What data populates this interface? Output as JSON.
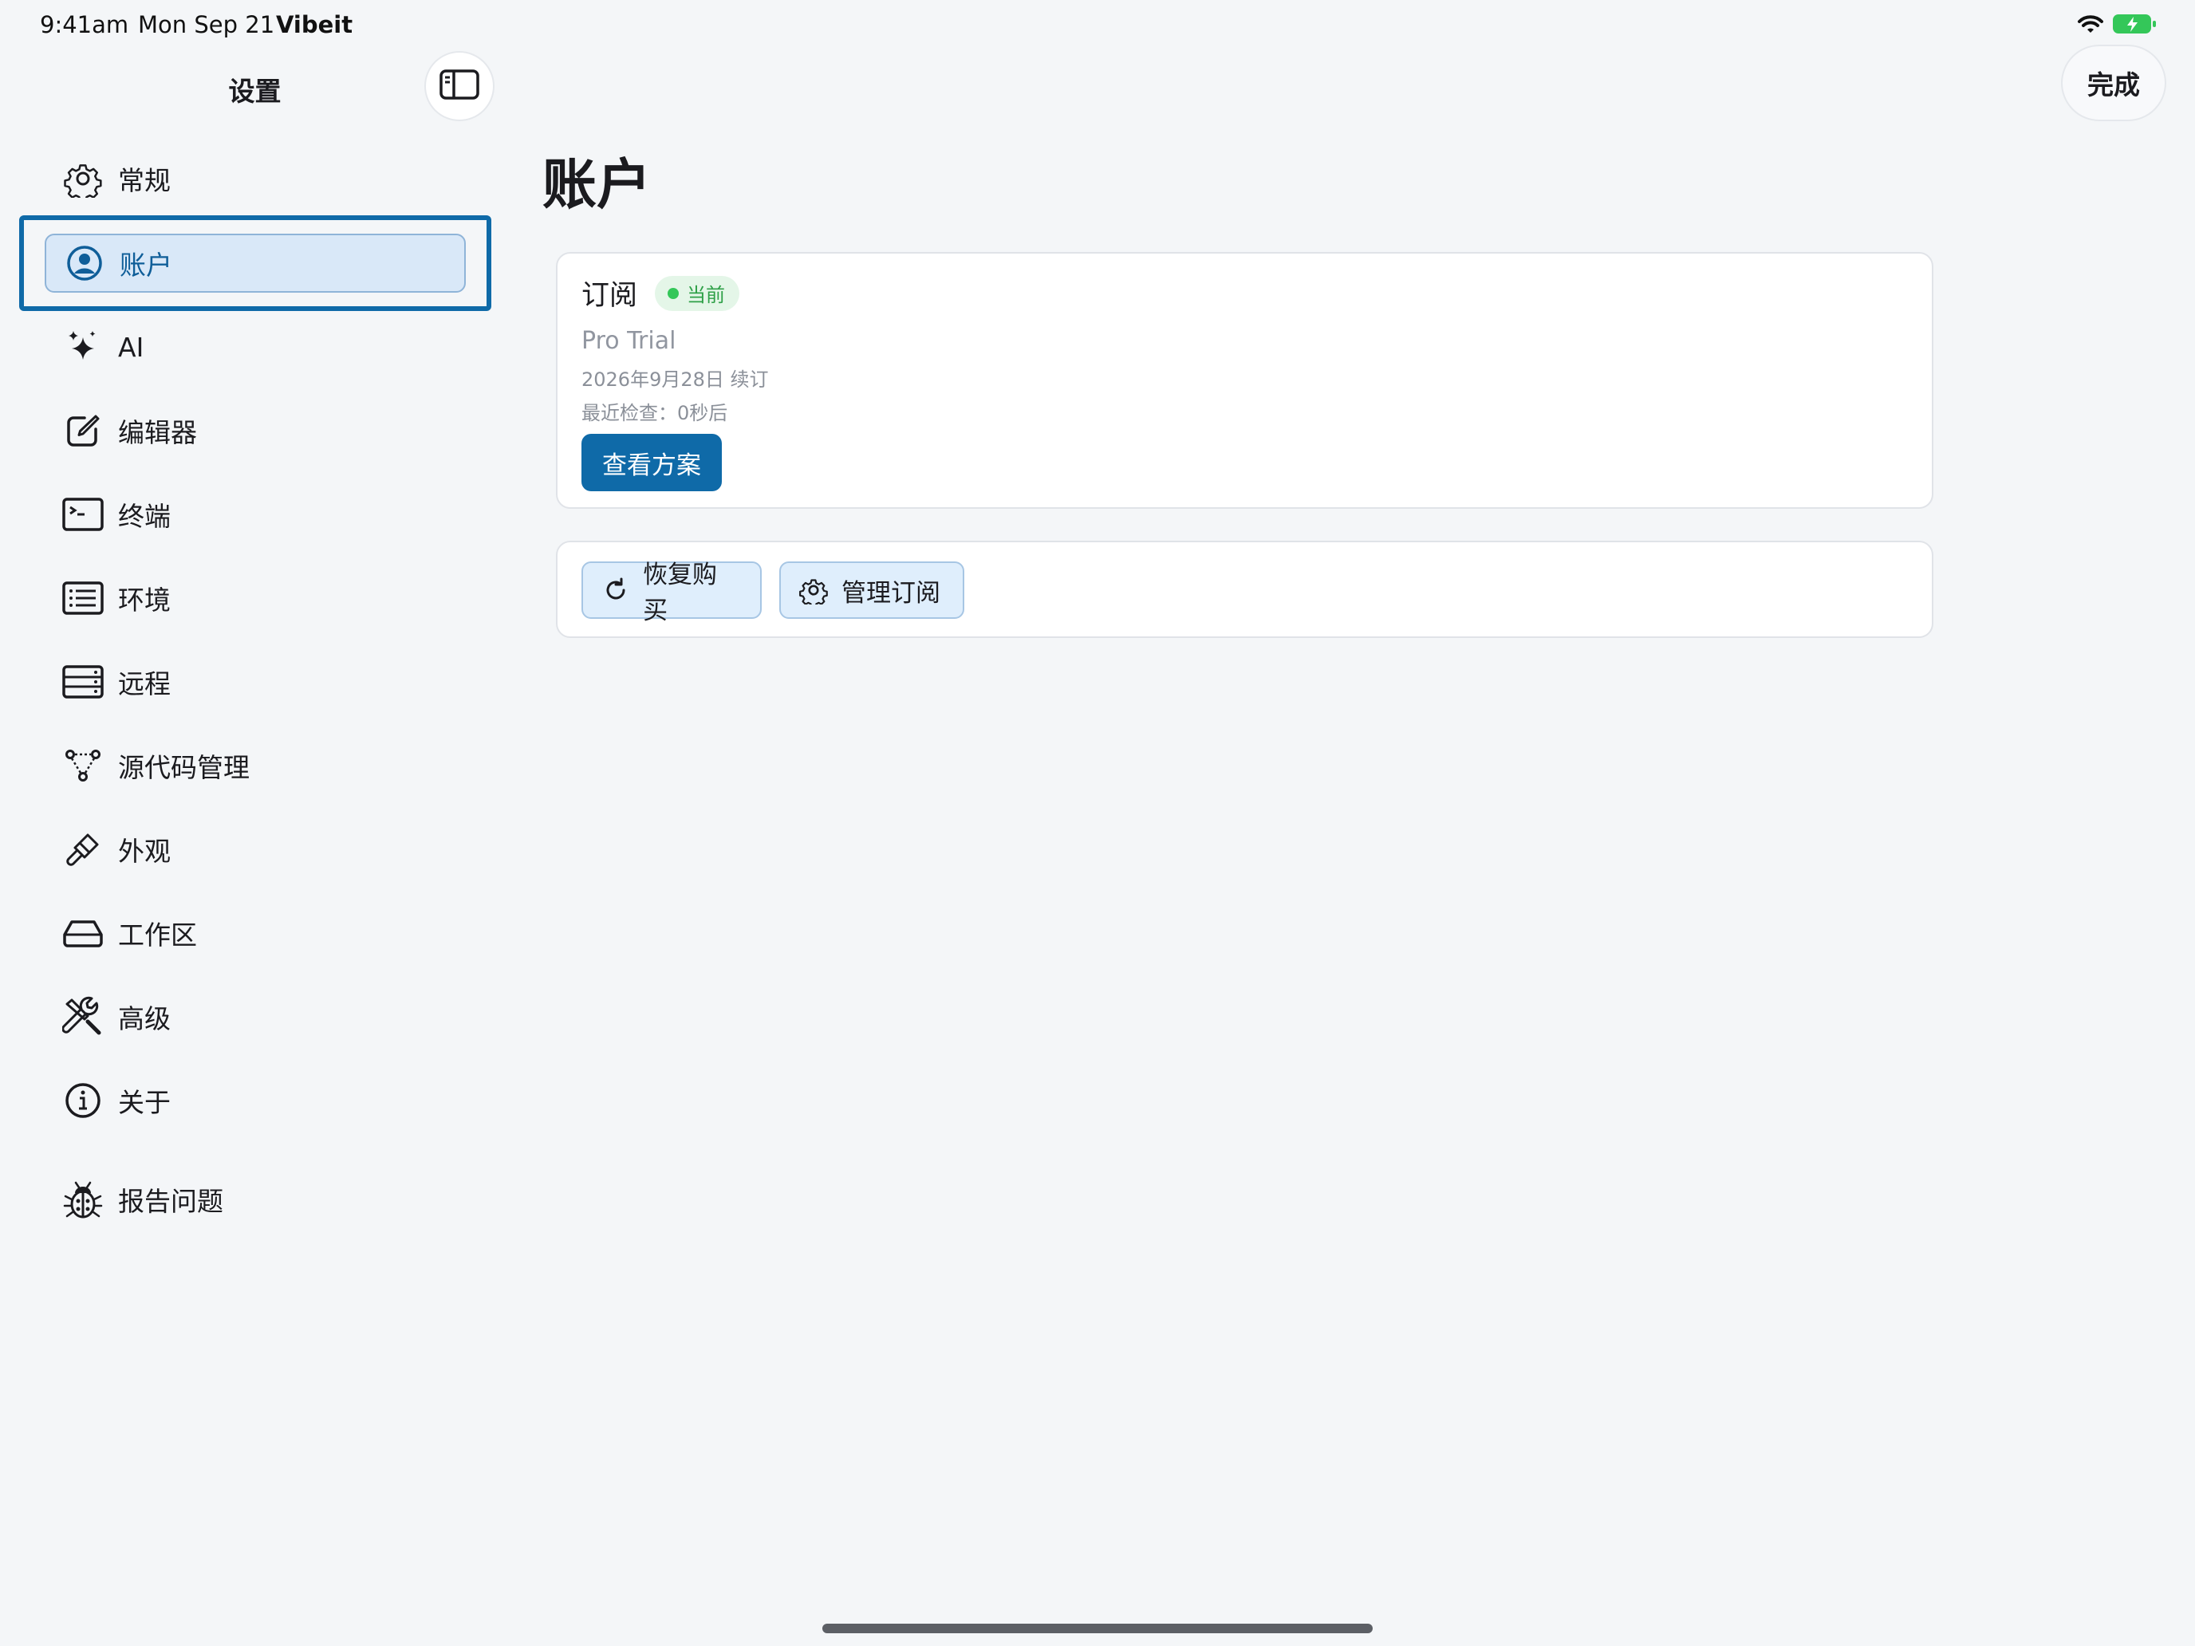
{
  "status_bar": {
    "time": "9:41am",
    "date": "Mon Sep 21",
    "app": "Vibeit",
    "battery_color": "#34c759"
  },
  "sidebar": {
    "title": "设置",
    "items": [
      {
        "label": "常规",
        "icon": "gear-icon"
      },
      {
        "label": "账户",
        "icon": "person-circle-icon",
        "selected": true
      },
      {
        "label": "AI",
        "icon": "sparkles-icon"
      },
      {
        "label": "编辑器",
        "icon": "square-pencil-icon"
      },
      {
        "label": "终端",
        "icon": "terminal-icon"
      },
      {
        "label": "环境",
        "icon": "list-icon"
      },
      {
        "label": "远程",
        "icon": "server-icon"
      },
      {
        "label": "源代码管理",
        "icon": "source-control-icon"
      },
      {
        "label": "外观",
        "icon": "paintbrush-icon"
      },
      {
        "label": "工作区",
        "icon": "drive-icon"
      },
      {
        "label": "高级",
        "icon": "tools-icon"
      },
      {
        "label": "关于",
        "icon": "info-icon"
      }
    ],
    "report": {
      "label": "报告问题",
      "icon": "bug-icon"
    }
  },
  "header": {
    "done_label": "完成"
  },
  "main": {
    "title": "账户",
    "subscription": {
      "title": "订阅",
      "badge": "当前",
      "plan": "Pro Trial",
      "renewal": "2026年9月28日 续订",
      "last_checked": "最近检查：0秒后",
      "view_plans_label": "查看方案"
    },
    "actions": {
      "restore_label": "恢复购买",
      "manage_label": "管理订阅"
    }
  },
  "colors": {
    "accent": "#0f6aa8",
    "selected_bg": "#d9e8f8",
    "badge_green": "#34c759"
  }
}
